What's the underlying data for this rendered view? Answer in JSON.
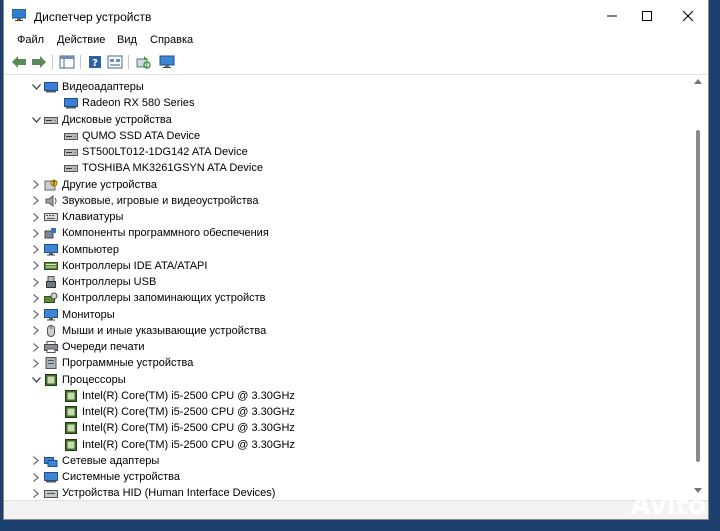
{
  "window": {
    "title": "Диспетчер устройств"
  },
  "menu": {
    "items": [
      "Файл",
      "Действие",
      "Вид",
      "Справка"
    ]
  },
  "toolbar": {
    "icons": [
      "back-arrow-icon",
      "forward-arrow-icon",
      "properties-icon",
      "help-icon",
      "properties-view-icon",
      "scan-hardware-icon",
      "monitor-icon"
    ]
  },
  "tree": [
    {
      "label": "Видеоадаптеры",
      "level": 1,
      "expanded": true,
      "icon": "display-adapter-icon"
    },
    {
      "label": "Radeon RX 580 Series",
      "level": 2,
      "icon": "display-adapter-icon"
    },
    {
      "label": "Дисковые устройства",
      "level": 1,
      "expanded": true,
      "icon": "disk-drive-icon"
    },
    {
      "label": "QUMO SSD ATA Device",
      "level": 2,
      "icon": "disk-drive-icon"
    },
    {
      "label": "ST500LT012-1DG142 ATA Device",
      "level": 2,
      "icon": "disk-drive-icon"
    },
    {
      "label": "TOSHIBA MK3261GSYN ATA Device",
      "level": 2,
      "icon": "disk-drive-icon"
    },
    {
      "label": "Другие устройства",
      "level": 1,
      "expanded": false,
      "icon": "unknown-device-icon"
    },
    {
      "label": "Звуковые, игровые и видеоустройства",
      "level": 1,
      "expanded": false,
      "icon": "speaker-icon"
    },
    {
      "label": "Клавиатуры",
      "level": 1,
      "expanded": false,
      "icon": "keyboard-icon"
    },
    {
      "label": "Компоненты программного обеспечения",
      "level": 1,
      "expanded": false,
      "icon": "software-component-icon"
    },
    {
      "label": "Компьютер",
      "level": 1,
      "expanded": false,
      "icon": "computer-icon"
    },
    {
      "label": "Контроллеры IDE ATA/ATAPI",
      "level": 1,
      "expanded": false,
      "icon": "ide-controller-icon"
    },
    {
      "label": "Контроллеры USB",
      "level": 1,
      "expanded": false,
      "icon": "usb-icon"
    },
    {
      "label": "Контроллеры запоминающих устройств",
      "level": 1,
      "expanded": false,
      "icon": "storage-controller-icon"
    },
    {
      "label": "Мониторы",
      "level": 1,
      "expanded": false,
      "icon": "monitor-icon"
    },
    {
      "label": "Мыши и иные указывающие устройства",
      "level": 1,
      "expanded": false,
      "icon": "mouse-icon"
    },
    {
      "label": "Очереди печати",
      "level": 1,
      "expanded": false,
      "icon": "printer-icon"
    },
    {
      "label": "Программные устройства",
      "level": 1,
      "expanded": false,
      "icon": "software-device-icon"
    },
    {
      "label": "Процессоры",
      "level": 1,
      "expanded": true,
      "icon": "processor-icon"
    },
    {
      "label": "Intel(R) Core(TM) i5-2500 CPU @ 3.30GHz",
      "level": 2,
      "icon": "processor-icon"
    },
    {
      "label": "Intel(R) Core(TM) i5-2500 CPU @ 3.30GHz",
      "level": 2,
      "icon": "processor-icon"
    },
    {
      "label": "Intel(R) Core(TM) i5-2500 CPU @ 3.30GHz",
      "level": 2,
      "icon": "processor-icon"
    },
    {
      "label": "Intel(R) Core(TM) i5-2500 CPU @ 3.30GHz",
      "level": 2,
      "icon": "processor-icon"
    },
    {
      "label": "Сетевые адаптеры",
      "level": 1,
      "expanded": false,
      "icon": "network-adapter-icon"
    },
    {
      "label": "Системные устройства",
      "level": 1,
      "expanded": false,
      "icon": "system-device-icon"
    },
    {
      "label": "Устройства HID (Human Interface Devices)",
      "level": 1,
      "expanded": false,
      "icon": "hid-icon"
    }
  ],
  "watermark": {
    "text": "Avito"
  }
}
